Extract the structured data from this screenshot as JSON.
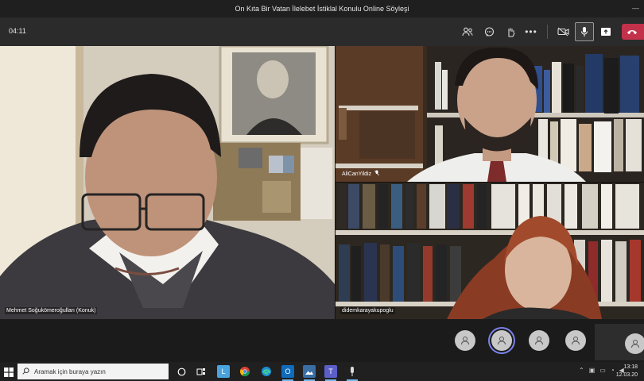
{
  "window": {
    "title": "On Kıta Bir Vatan İlelebet İstiklal Konulu Online Söyleşi"
  },
  "toolbar": {
    "timer": "04:11",
    "icons": [
      "people-icon",
      "chat-icon",
      "raise-hand-icon",
      "more-icon",
      "camera-off-icon",
      "mic-icon",
      "share-icon",
      "hang-up-icon"
    ]
  },
  "participants": {
    "main": {
      "name": "Mehmet Soğukömeroğulları (Konuk)"
    },
    "top_right": {
      "name": "AliCanYildiz"
    },
    "bottom_right": {
      "name": "didemkarayakupoglu"
    }
  },
  "taskbar": {
    "search_placeholder": "Aramak için buraya yazın",
    "time": "13:18",
    "date": "12.03.20"
  },
  "colors": {
    "accent": "#7b83eb",
    "leave": "#c4314b"
  }
}
